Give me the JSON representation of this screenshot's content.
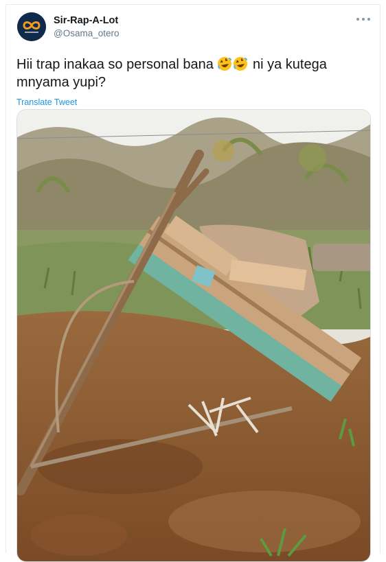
{
  "tweet": {
    "author_name": "Sir-Rap-A-Lot",
    "author_handle": "@Osama_otero",
    "text_part1": "Hii trap inakaa so personal bana ",
    "text_part2": " ni ya kutega mnyama yupi?",
    "emoji": "rolling-on-floor-laughing",
    "translate_label": "Translate Tweet"
  },
  "icons": {
    "more": "more-horizontal-icon",
    "avatar": "infinity-logo"
  },
  "colors": {
    "link": "#1b95e0",
    "handle": "#657786"
  }
}
